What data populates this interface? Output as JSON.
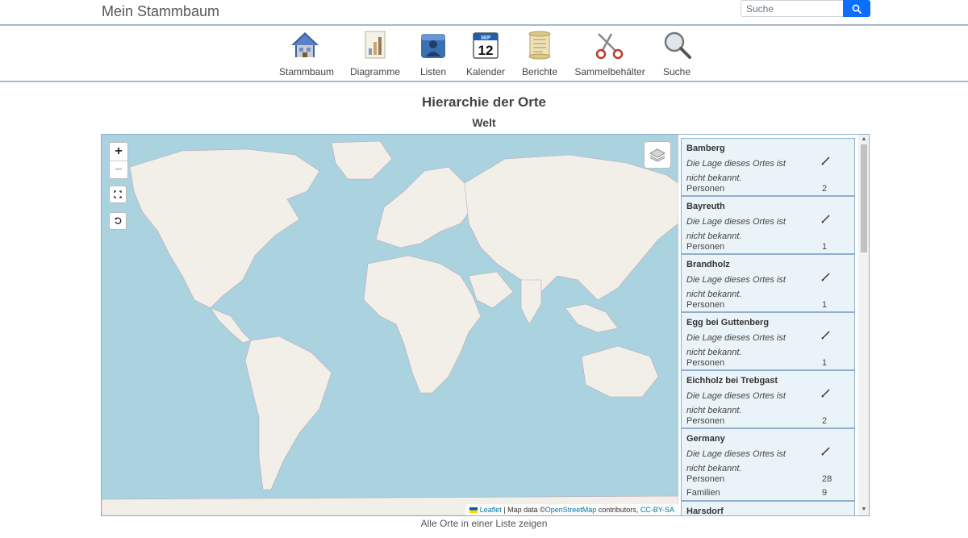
{
  "header": {
    "brand": "Mein Stammbaum",
    "search_placeholder": "Suche"
  },
  "menu": [
    {
      "label": "Stammbaum",
      "icon": "house-icon"
    },
    {
      "label": "Diagramme",
      "icon": "chart-icon"
    },
    {
      "label": "Listen",
      "icon": "people-icon"
    },
    {
      "label": "Kalender",
      "icon": "calendar-icon"
    },
    {
      "label": "Berichte",
      "icon": "scroll-icon"
    },
    {
      "label": "Sammelbehälter",
      "icon": "scissors-icon"
    },
    {
      "label": "Suche",
      "icon": "magnifier-icon"
    }
  ],
  "calendar_day": "12",
  "calendar_month": "SEP",
  "page": {
    "title": "Hierarchie der Orte",
    "subtitle": "Welt",
    "show_all_link": "Alle Orte in einer Liste zeigen"
  },
  "map": {
    "zoom_in": "+",
    "zoom_out": "−",
    "attribution": {
      "leaflet": "Leaflet",
      "sep": " | Map data ©",
      "osm": "OpenStreetMap",
      "contrib": " contributors, ",
      "license": "CC-BY-SA"
    }
  },
  "places": [
    {
      "name": "Bamberg",
      "note": "Die Lage dieses Ortes ist nicht bekannt.",
      "persons_label": "Personen",
      "persons": "2"
    },
    {
      "name": "Bayreuth",
      "note": "Die Lage dieses Ortes ist nicht bekannt.",
      "persons_label": "Personen",
      "persons": "1"
    },
    {
      "name": "Brandholz",
      "note": "Die Lage dieses Ortes ist nicht bekannt.",
      "persons_label": "Personen",
      "persons": "1"
    },
    {
      "name": "Egg bei Guttenberg",
      "note": "Die Lage dieses Ortes ist nicht bekannt.",
      "persons_label": "Personen",
      "persons": "1"
    },
    {
      "name": "Eichholz bei Trebgast",
      "note": "Die Lage dieses Ortes ist nicht bekannt.",
      "persons_label": "Personen",
      "persons": "2"
    },
    {
      "name": "Germany",
      "note": "Die Lage dieses Ortes ist nicht bekannt.",
      "persons_label": "Personen",
      "persons": "28",
      "families_label": "Familien",
      "families": "9"
    },
    {
      "name": "Harsdorf",
      "note": "",
      "persons_label": "",
      "persons": ""
    }
  ],
  "colors": {
    "water": "#aad3df",
    "land": "#f2efe9",
    "card": "#eaf4f8",
    "accent": "#0d6efd"
  }
}
